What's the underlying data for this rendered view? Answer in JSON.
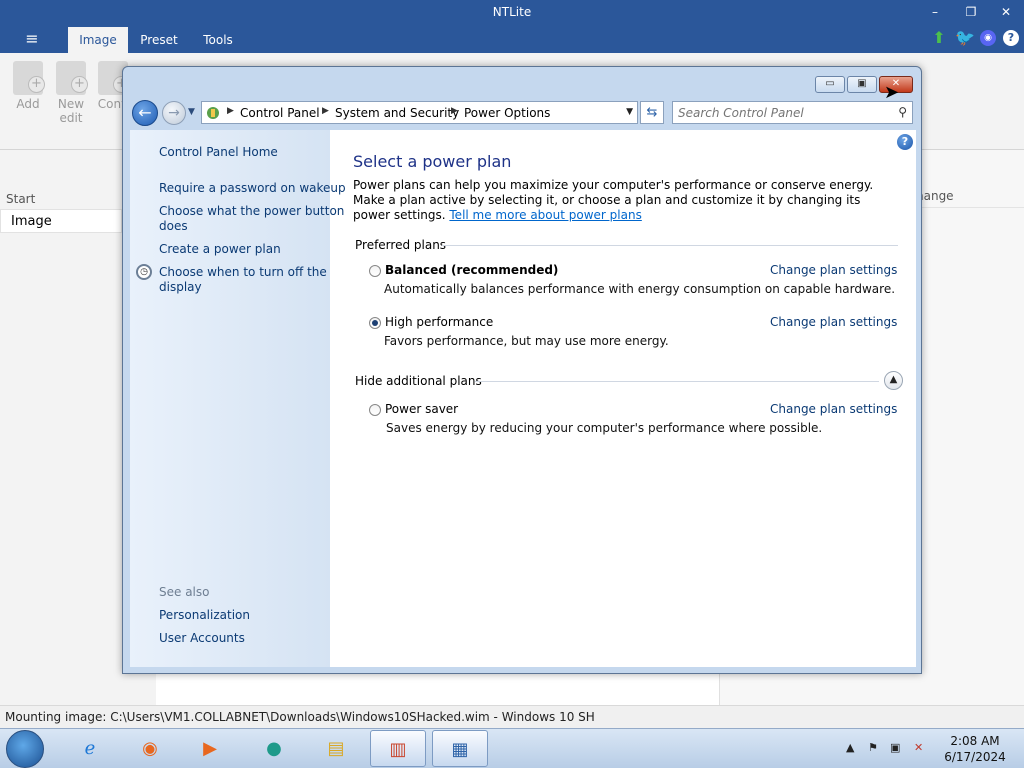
{
  "ntlite": {
    "title": "NTLite",
    "controls": {
      "minimize": "–",
      "restore": "❐",
      "close": "✕"
    },
    "menu_icon": "≡",
    "tabs": [
      {
        "label": "Image",
        "active": true
      },
      {
        "label": "Preset",
        "active": false
      },
      {
        "label": "Tools",
        "active": false
      }
    ],
    "header_icons": [
      "arrow-up-icon",
      "twitter-icon",
      "discord-icon",
      "help-icon"
    ],
    "ribbon": {
      "add": "Add",
      "new_edit": "New\nedit",
      "convert": "Conv"
    },
    "left_header": "Start",
    "left_item": "Image",
    "right_header": "hange",
    "status": "Mounting image: C:\\Users\\VM1.COLLABNET\\Downloads\\Windows10SHacked.wim - Windows 10 SH"
  },
  "control_panel": {
    "controls": {
      "minimize": "▭",
      "maximize": "▣",
      "close": "✕"
    },
    "breadcrumb": [
      "Control Panel",
      "System and Security",
      "Power Options"
    ],
    "search_placeholder": "Search Control Panel",
    "left_links": [
      "Control Panel Home",
      "Require a password on wakeup",
      "Choose what the power button",
      "does",
      "Create a power plan",
      "Choose when to turn off the",
      "display"
    ],
    "see_also_label": "See also",
    "see_also": [
      "Personalization",
      "User Accounts"
    ],
    "title": "Select a power plan",
    "description_1": "Power plans can help you maximize your computer's performance or conserve energy. Make a plan active by selecting it, or choose a plan and customize it by changing its power settings. ",
    "description_link": "Tell me more about power plans",
    "preferred_header": "Preferred plans",
    "additional_header": "Hide additional plans",
    "change_link": "Change plan settings",
    "plans": [
      {
        "name": "Balanced (recommended)",
        "desc": "Automatically balances performance with energy consumption on capable hardware.",
        "selected": false,
        "bold": true
      },
      {
        "name": "High performance",
        "desc": "Favors performance, but may use more energy.",
        "selected": true,
        "bold": false
      },
      {
        "name": "Power saver",
        "desc": "Saves energy by reducing your computer's performance where possible.",
        "selected": false,
        "bold": false
      }
    ]
  },
  "taskbar": {
    "items": [
      "internet-explorer-icon",
      "firefox-icon",
      "media-player-icon",
      "app-icon",
      "file-explorer-icon",
      "winrar-icon",
      "control-panel-icon"
    ],
    "time": "2:08 AM",
    "date": "6/17/2024"
  },
  "colors": {
    "ntlite_blue": "#2b579a",
    "link": "#0b3a74",
    "title_blue": "#1e3287"
  }
}
